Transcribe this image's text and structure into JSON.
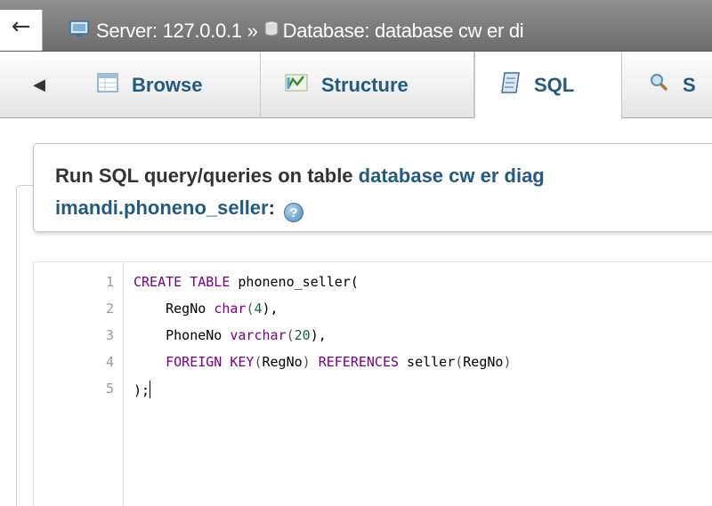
{
  "breadcrumb": {
    "back_arrow": "←",
    "server_label": "Server: 127.0.0.1",
    "separator": "»",
    "database_label": "Database: database cw er di",
    "server_icon": "server-icon",
    "database_icon": "database-icon"
  },
  "tabs": [
    {
      "label": "Browse",
      "icon": "browse-icon"
    },
    {
      "label": "Structure",
      "icon": "structure-icon"
    },
    {
      "label": "SQL",
      "icon": "sql-icon",
      "active": true
    },
    {
      "label": "S",
      "icon": "search-icon"
    }
  ],
  "tab_scroll_arrow": "◀",
  "query_header": {
    "prefix": "Run SQL query/queries on table ",
    "table_part1": "database cw er diag",
    "table_part2": "imandi.phoneno_seller",
    "suffix": ":",
    "help_glyph": "?"
  },
  "editor": {
    "line_numbers": [
      "1",
      "2",
      "3",
      "4",
      "5"
    ],
    "lines": {
      "l1_kw": "CREATE TABLE",
      "l1_rest": " phoneno_seller(",
      "l2_indent": "    ",
      "l2_col": "RegNo ",
      "l2_type": "char",
      "l2_open": "(",
      "l2_num": "4",
      "l2_close": "),",
      "l3_indent": "    ",
      "l3_col": "PhoneNo ",
      "l3_type": "varchar",
      "l3_open": "(",
      "l3_num": "20",
      "l3_close": "),",
      "l4_indent": "    ",
      "l4_kw1": "FOREIGN KEY",
      "l4_p1": "(",
      "l4_col": "RegNo",
      "l4_p2": ") ",
      "l4_kw2": "REFERENCES",
      "l4_ref": " seller",
      "l4_p3": "(",
      "l4_refcol": "RegNo",
      "l4_p4": ")",
      "l5_text": ");"
    }
  },
  "colors": {
    "keyword": "#770088",
    "number": "#116644",
    "link": "#235a81",
    "topbar": "#7a7a7a"
  }
}
